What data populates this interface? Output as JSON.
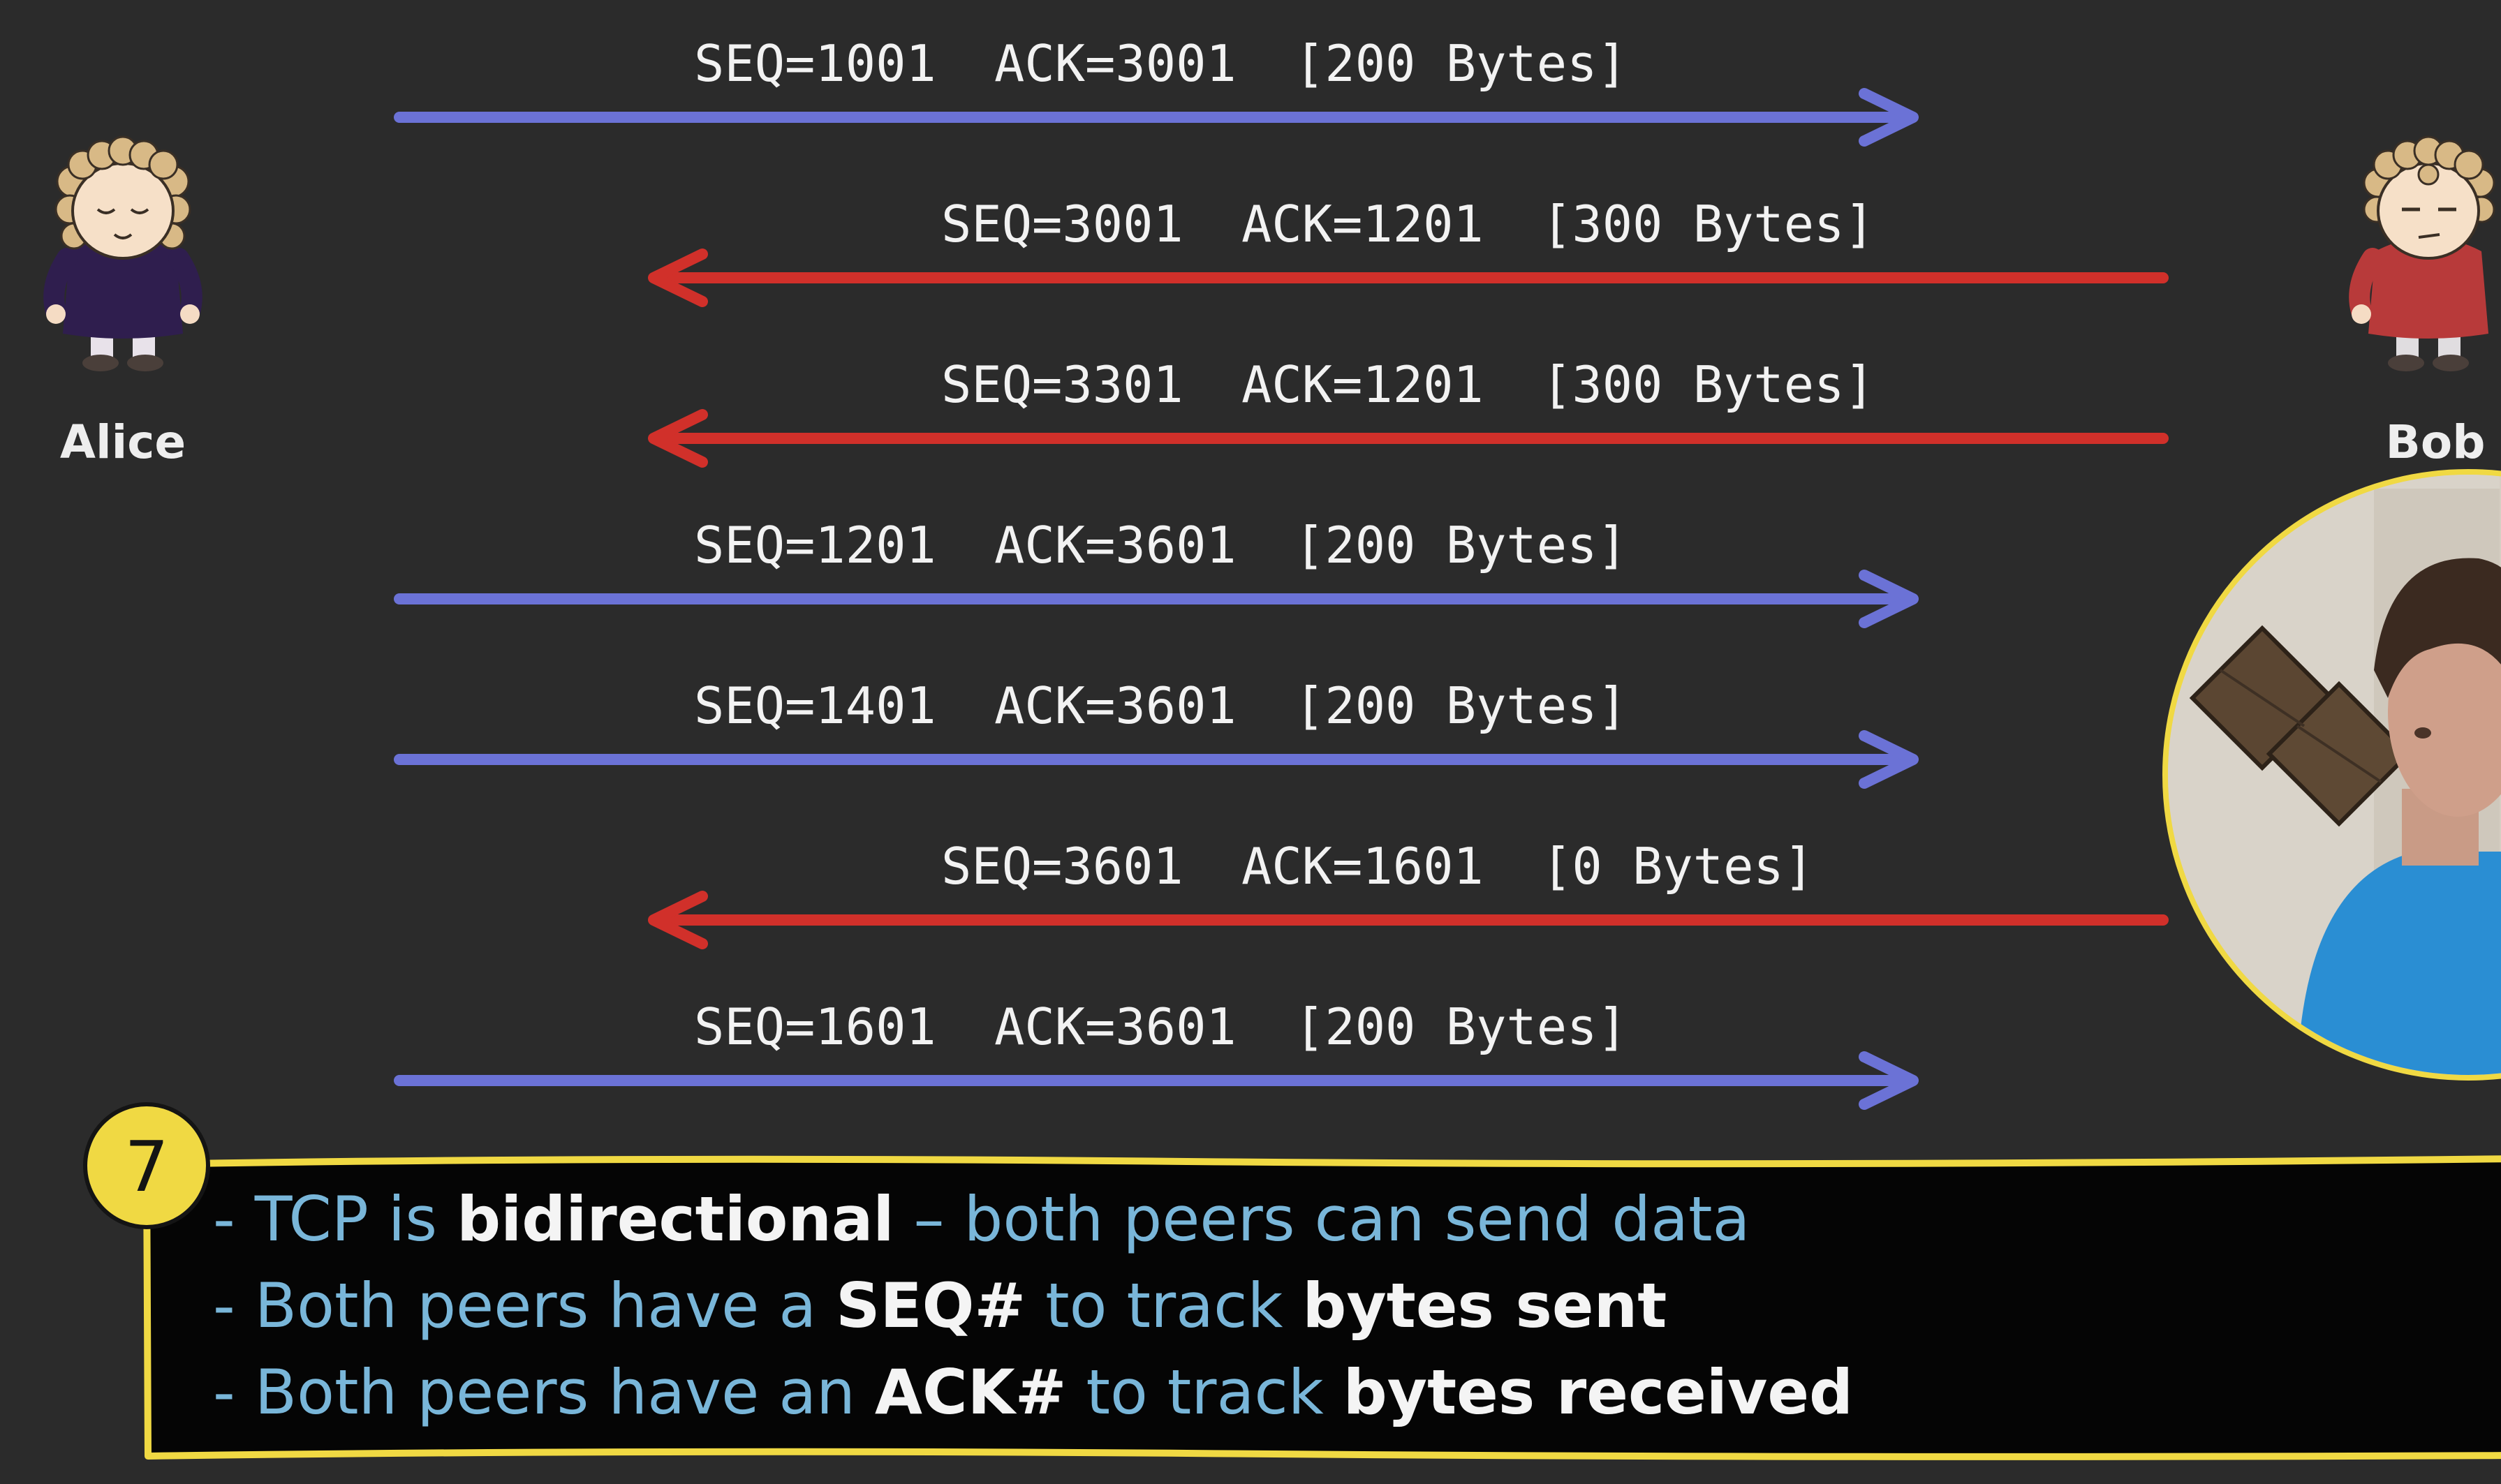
{
  "peers": {
    "left": {
      "name": "Alice",
      "shirt_color": "#2f1e4e"
    },
    "right": {
      "name": "Bob",
      "shirt_color": "#b83a3a"
    }
  },
  "colors": {
    "background": "#2b2b2b",
    "alice_to_bob": "#6b72d6",
    "bob_to_alice": "#d1302a",
    "highlight": "#f0d943",
    "note_blue": "#79b6d9",
    "note_white": "#f4f4f4"
  },
  "messages": [
    {
      "direction": "alice-to-bob",
      "seq": "SEQ=1001",
      "ack": "ACK=3001",
      "size": "[200 Bytes]"
    },
    {
      "direction": "bob-to-alice",
      "seq": "SEQ=3001",
      "ack": "ACK=1201",
      "size": "[300 Bytes]"
    },
    {
      "direction": "bob-to-alice",
      "seq": "SEQ=3301",
      "ack": "ACK=1201",
      "size": "[300 Bytes]"
    },
    {
      "direction": "alice-to-bob",
      "seq": "SEQ=1201",
      "ack": "ACK=3601",
      "size": "[200 Bytes]"
    },
    {
      "direction": "alice-to-bob",
      "seq": "SEQ=1401",
      "ack": "ACK=3601",
      "size": "[200 Bytes]"
    },
    {
      "direction": "bob-to-alice",
      "seq": "SEQ=3601",
      "ack": "ACK=1601",
      "size": "[0 Bytes]"
    },
    {
      "direction": "alice-to-bob",
      "seq": "SEQ=1601",
      "ack": "ACK=3601",
      "size": "[200 Bytes]"
    }
  ],
  "note": {
    "badge": "7",
    "lines": [
      [
        {
          "text": "- TCP is ",
          "style": "blue"
        },
        {
          "text": "bidirectional",
          "style": "white"
        },
        {
          "text": " – both peers can send data",
          "style": "blue"
        }
      ],
      [
        {
          "text": "- Both peers have a ",
          "style": "blue"
        },
        {
          "text": "SEQ#",
          "style": "white"
        },
        {
          "text": " to track ",
          "style": "blue"
        },
        {
          "text": "bytes sent",
          "style": "white"
        }
      ],
      [
        {
          "text": "- Both peers have an ",
          "style": "blue"
        },
        {
          "text": "ACK#",
          "style": "white"
        },
        {
          "text": " to track ",
          "style": "blue"
        },
        {
          "text": "bytes received",
          "style": "white"
        }
      ]
    ]
  }
}
